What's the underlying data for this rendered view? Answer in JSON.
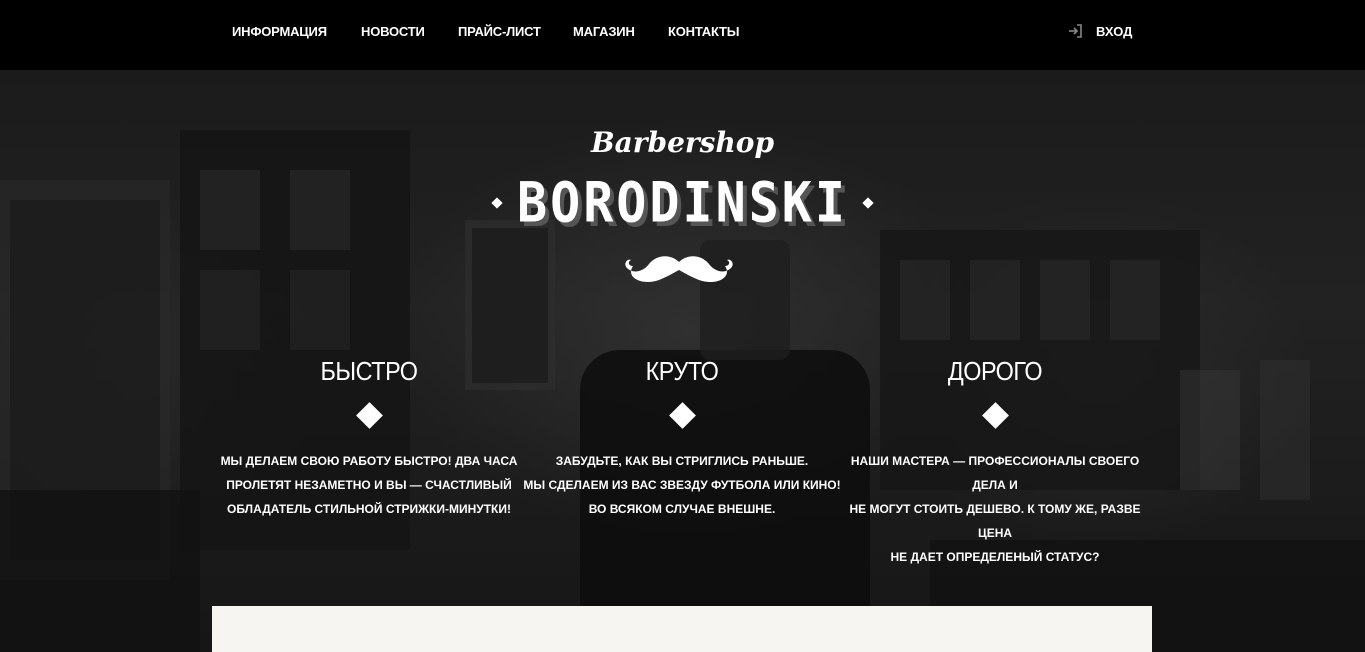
{
  "nav": {
    "links": [
      "ИНФОРМАЦИЯ",
      "НОВОСТИ",
      "ПРАЙС-ЛИСТ",
      "МАГАЗИН",
      "КОНТАКТЫ"
    ],
    "login_label": "ВХОД",
    "login_icon": "sign-in-icon"
  },
  "brand": {
    "script": "Barbershop",
    "name": "BORODINSKI",
    "logo_icon": "mustache-icon"
  },
  "features": [
    {
      "title": "БЫСТРО",
      "lines": [
        "МЫ ДЕЛАЕМ СВОЮ РАБОТУ БЫСТРО! ДВА ЧАСА",
        "ПРОЛЕТЯТ НЕЗАМЕТНО И ВЫ — СЧАСТЛИВЫЙ",
        "ОБЛАДАТЕЛЬ СТИЛЬНОЙ СТРИЖКИ-МИНУТКИ!"
      ]
    },
    {
      "title": "КРУТО",
      "lines": [
        "ЗАБУДЬТЕ, КАК ВЫ СТРИГЛИСЬ РАНЬШЕ.",
        "МЫ СДЕЛАЕМ ИЗ ВАС ЗВЕЗДУ ФУТБОЛА ИЛИ КИНО!",
        "ВО ВСЯКОМ СЛУЧАЕ ВНЕШНЕ."
      ]
    },
    {
      "title": "ДОРОГО",
      "lines": [
        "НАШИ МАСТЕРА — ПРОФЕССИОНАЛЫ СВОЕГО ДЕЛА И",
        "НЕ МОГУТ СТОИТЬ ДЕШЕВО. К ТОМУ ЖЕ, РАЗВЕ ЦЕНА",
        "НЕ ДАЕТ ОПРЕДЕЛЕНЫЙ СТАТУС?"
      ]
    }
  ],
  "colors": {
    "nav_bg": "#000000",
    "text": "#ffffff",
    "panel_bg": "#f7f5f2"
  }
}
